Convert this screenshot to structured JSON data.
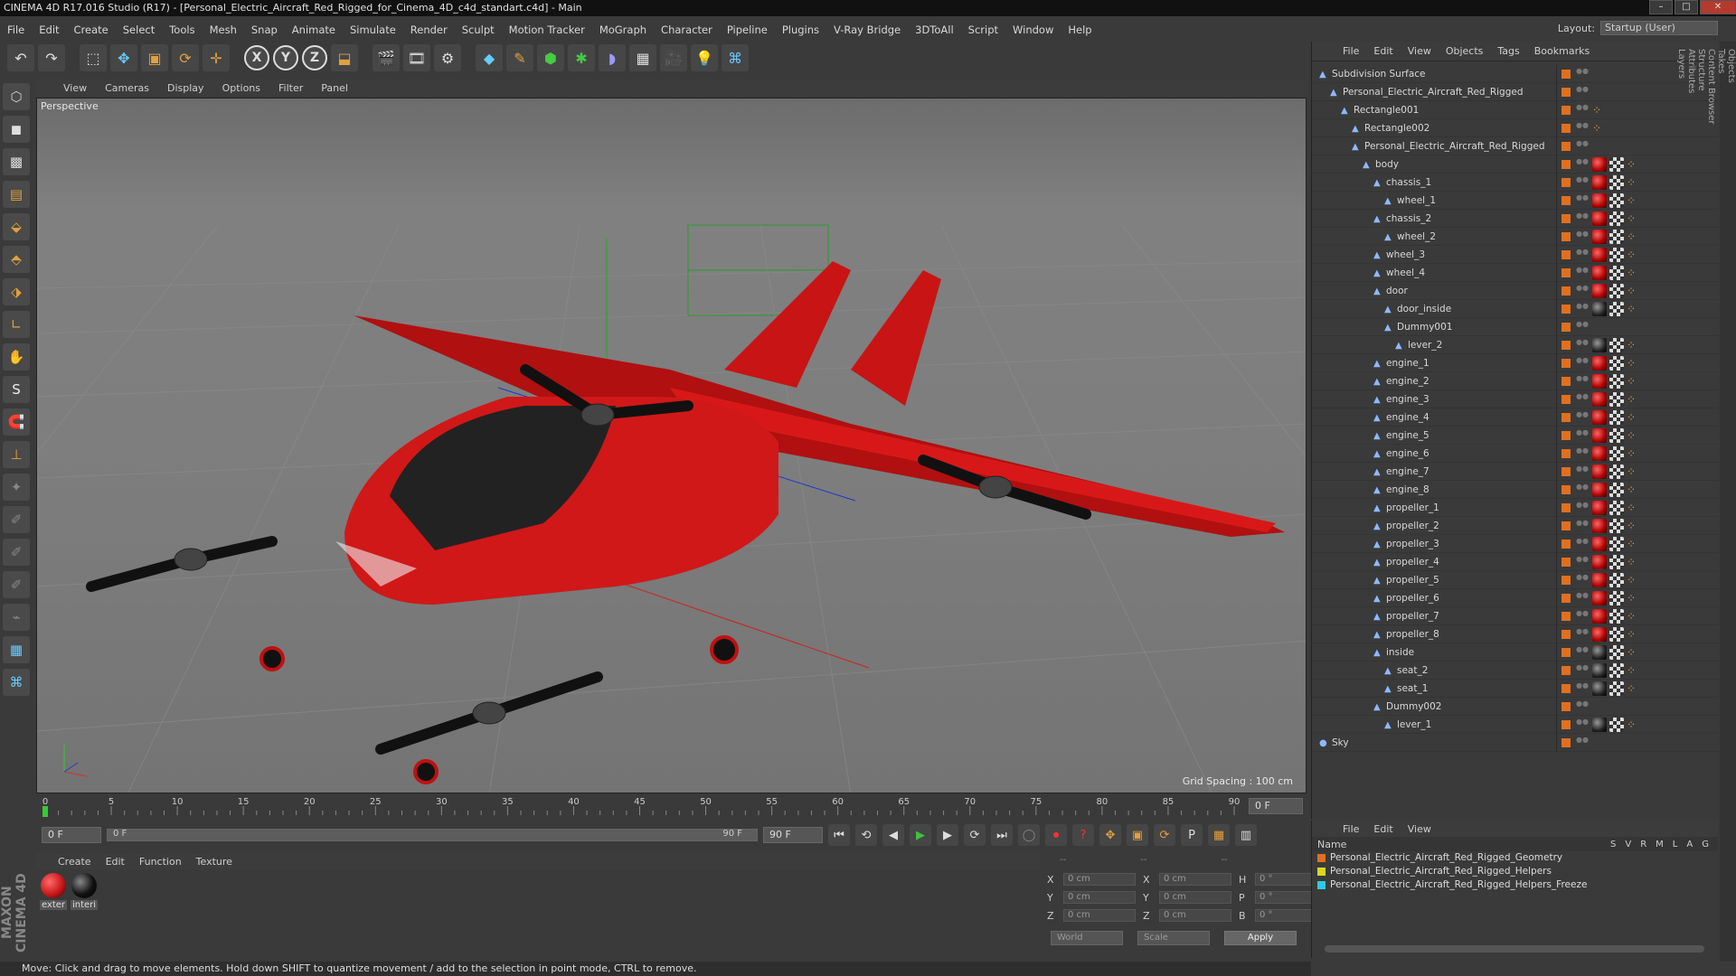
{
  "window": {
    "title": "CINEMA 4D R17.016 Studio (R17) - [Personal_Electric_Aircraft_Red_Rigged_for_Cinema_4D_c4d_standart.c4d] - Main"
  },
  "menu": [
    "File",
    "Edit",
    "Create",
    "Select",
    "Tools",
    "Mesh",
    "Snap",
    "Animate",
    "Simulate",
    "Render",
    "Sculpt",
    "Motion Tracker",
    "MoGraph",
    "Character",
    "Pipeline",
    "Plugins",
    "V-Ray Bridge",
    "3DToAll",
    "Script",
    "Window",
    "Help"
  ],
  "layout": {
    "label": "Layout:",
    "value": "Startup (User)"
  },
  "toolbar": {
    "axis_x": "X",
    "axis_y": "Y",
    "axis_z": "Z"
  },
  "viewport": {
    "menu": [
      "View",
      "Cameras",
      "Display",
      "Options",
      "Filter",
      "Panel"
    ],
    "camera_label": "Perspective",
    "grid_spacing": "Grid Spacing : 100 cm"
  },
  "timeline": {
    "ticks": [
      "0",
      "5",
      "10",
      "15",
      "20",
      "25",
      "30",
      "35",
      "40",
      "45",
      "50",
      "55",
      "60",
      "65",
      "70",
      "75",
      "80",
      "85",
      "90"
    ],
    "current_frame": "0 F",
    "start_field": "0 F",
    "slider_start": "0 F",
    "slider_end": "90 F",
    "end_field": "90 F"
  },
  "materials": {
    "menu": [
      "Create",
      "Edit",
      "Function",
      "Texture"
    ],
    "items": [
      {
        "label": "exter",
        "color": "#c81818"
      },
      {
        "label": "interi",
        "color": "#111111"
      }
    ]
  },
  "coords": {
    "headers": [
      "--",
      "--",
      "--"
    ],
    "rows": [
      {
        "a": "X",
        "av": "0 cm",
        "b": "X",
        "bv": "0 cm",
        "c": "H",
        "cv": "0 °"
      },
      {
        "a": "Y",
        "av": "0 cm",
        "b": "Y",
        "bv": "0 cm",
        "c": "P",
        "cv": "0 °"
      },
      {
        "a": "Z",
        "av": "0 cm",
        "b": "Z",
        "bv": "0 cm",
        "c": "B",
        "cv": "0 °"
      }
    ],
    "mode": "World",
    "transform": "Scale",
    "apply": "Apply"
  },
  "status": "Move: Click and drag to move elements. Hold down SHIFT to quantize movement / add to the selection in point mode, CTRL to remove.",
  "objects": {
    "menu": [
      "File",
      "Edit",
      "View",
      "Objects",
      "Tags",
      "Bookmarks"
    ],
    "items": [
      {
        "name": "Subdivision Surface",
        "depth": 0,
        "tags": []
      },
      {
        "name": "Personal_Electric_Aircraft_Red_Rigged",
        "depth": 1,
        "tags": []
      },
      {
        "name": "Rectangle001",
        "depth": 2,
        "tags": [
          "dot"
        ]
      },
      {
        "name": "Rectangle002",
        "depth": 3,
        "tags": [
          "dot"
        ]
      },
      {
        "name": "Personal_Electric_Aircraft_Red_Rigged",
        "depth": 3,
        "tags": []
      },
      {
        "name": "body",
        "depth": 4,
        "tags": [
          "red",
          "chk",
          "dot"
        ]
      },
      {
        "name": "chassis_1",
        "depth": 5,
        "tags": [
          "red",
          "chk",
          "dot"
        ]
      },
      {
        "name": "wheel_1",
        "depth": 6,
        "tags": [
          "red",
          "chk",
          "dot"
        ]
      },
      {
        "name": "chassis_2",
        "depth": 5,
        "tags": [
          "red",
          "chk",
          "dot"
        ]
      },
      {
        "name": "wheel_2",
        "depth": 6,
        "tags": [
          "red",
          "chk",
          "dot"
        ]
      },
      {
        "name": "wheel_3",
        "depth": 5,
        "tags": [
          "red",
          "chk",
          "dot"
        ]
      },
      {
        "name": "wheel_4",
        "depth": 5,
        "tags": [
          "red",
          "chk",
          "dot"
        ]
      },
      {
        "name": "door",
        "depth": 5,
        "tags": [
          "red",
          "chk",
          "dot"
        ]
      },
      {
        "name": "door_inside",
        "depth": 6,
        "tags": [
          "blk",
          "chk",
          "dot"
        ]
      },
      {
        "name": "Dummy001",
        "depth": 6,
        "tags": []
      },
      {
        "name": "lever_2",
        "depth": 7,
        "tags": [
          "blk",
          "chk",
          "dot"
        ]
      },
      {
        "name": "engine_1",
        "depth": 5,
        "tags": [
          "red",
          "chk",
          "dot"
        ]
      },
      {
        "name": "engine_2",
        "depth": 5,
        "tags": [
          "red",
          "chk",
          "dot"
        ]
      },
      {
        "name": "engine_3",
        "depth": 5,
        "tags": [
          "red",
          "chk",
          "dot"
        ]
      },
      {
        "name": "engine_4",
        "depth": 5,
        "tags": [
          "red",
          "chk",
          "dot"
        ]
      },
      {
        "name": "engine_5",
        "depth": 5,
        "tags": [
          "red",
          "chk",
          "dot"
        ]
      },
      {
        "name": "engine_6",
        "depth": 5,
        "tags": [
          "red",
          "chk",
          "dot"
        ]
      },
      {
        "name": "engine_7",
        "depth": 5,
        "tags": [
          "red",
          "chk",
          "dot"
        ]
      },
      {
        "name": "engine_8",
        "depth": 5,
        "tags": [
          "red",
          "chk",
          "dot"
        ]
      },
      {
        "name": "propeller_1",
        "depth": 5,
        "tags": [
          "red",
          "chk",
          "dot"
        ]
      },
      {
        "name": "propeller_2",
        "depth": 5,
        "tags": [
          "red",
          "chk",
          "dot"
        ]
      },
      {
        "name": "propeller_3",
        "depth": 5,
        "tags": [
          "red",
          "chk",
          "dot"
        ]
      },
      {
        "name": "propeller_4",
        "depth": 5,
        "tags": [
          "red",
          "chk",
          "dot"
        ]
      },
      {
        "name": "propeller_5",
        "depth": 5,
        "tags": [
          "red",
          "chk",
          "dot"
        ]
      },
      {
        "name": "propeller_6",
        "depth": 5,
        "tags": [
          "red",
          "chk",
          "dot"
        ]
      },
      {
        "name": "propeller_7",
        "depth": 5,
        "tags": [
          "red",
          "chk",
          "dot"
        ]
      },
      {
        "name": "propeller_8",
        "depth": 5,
        "tags": [
          "red",
          "chk",
          "dot"
        ]
      },
      {
        "name": "inside",
        "depth": 5,
        "tags": [
          "blk",
          "chk",
          "dot"
        ]
      },
      {
        "name": "seat_2",
        "depth": 6,
        "tags": [
          "blk",
          "chk",
          "dot"
        ]
      },
      {
        "name": "seat_1",
        "depth": 6,
        "tags": [
          "blk",
          "chk",
          "dot"
        ]
      },
      {
        "name": "Dummy002",
        "depth": 5,
        "tags": []
      },
      {
        "name": "lever_1",
        "depth": 6,
        "tags": [
          "blk",
          "chk",
          "dot"
        ]
      },
      {
        "name": "Sky",
        "depth": 0,
        "tags": []
      }
    ]
  },
  "layers": {
    "menu": [
      "File",
      "Edit",
      "View"
    ],
    "column_name": "Name",
    "flags": [
      "S",
      "V",
      "R",
      "M",
      "L",
      "A",
      "G"
    ],
    "items": [
      {
        "name": "Personal_Electric_Aircraft_Red_Rigged_Geometry",
        "color": "#e07020"
      },
      {
        "name": "Personal_Electric_Aircraft_Red_Rigged_Helpers",
        "color": "#d8d820"
      },
      {
        "name": "Personal_Electric_Aircraft_Red_Rigged_Helpers_Freeze",
        "color": "#30c8e0"
      }
    ]
  },
  "side_tabs": [
    "Objects",
    "Takes",
    "Content Browser",
    "Structure"
  ],
  "side_tabs_bottom": [
    "Attributes",
    "Layers"
  ]
}
